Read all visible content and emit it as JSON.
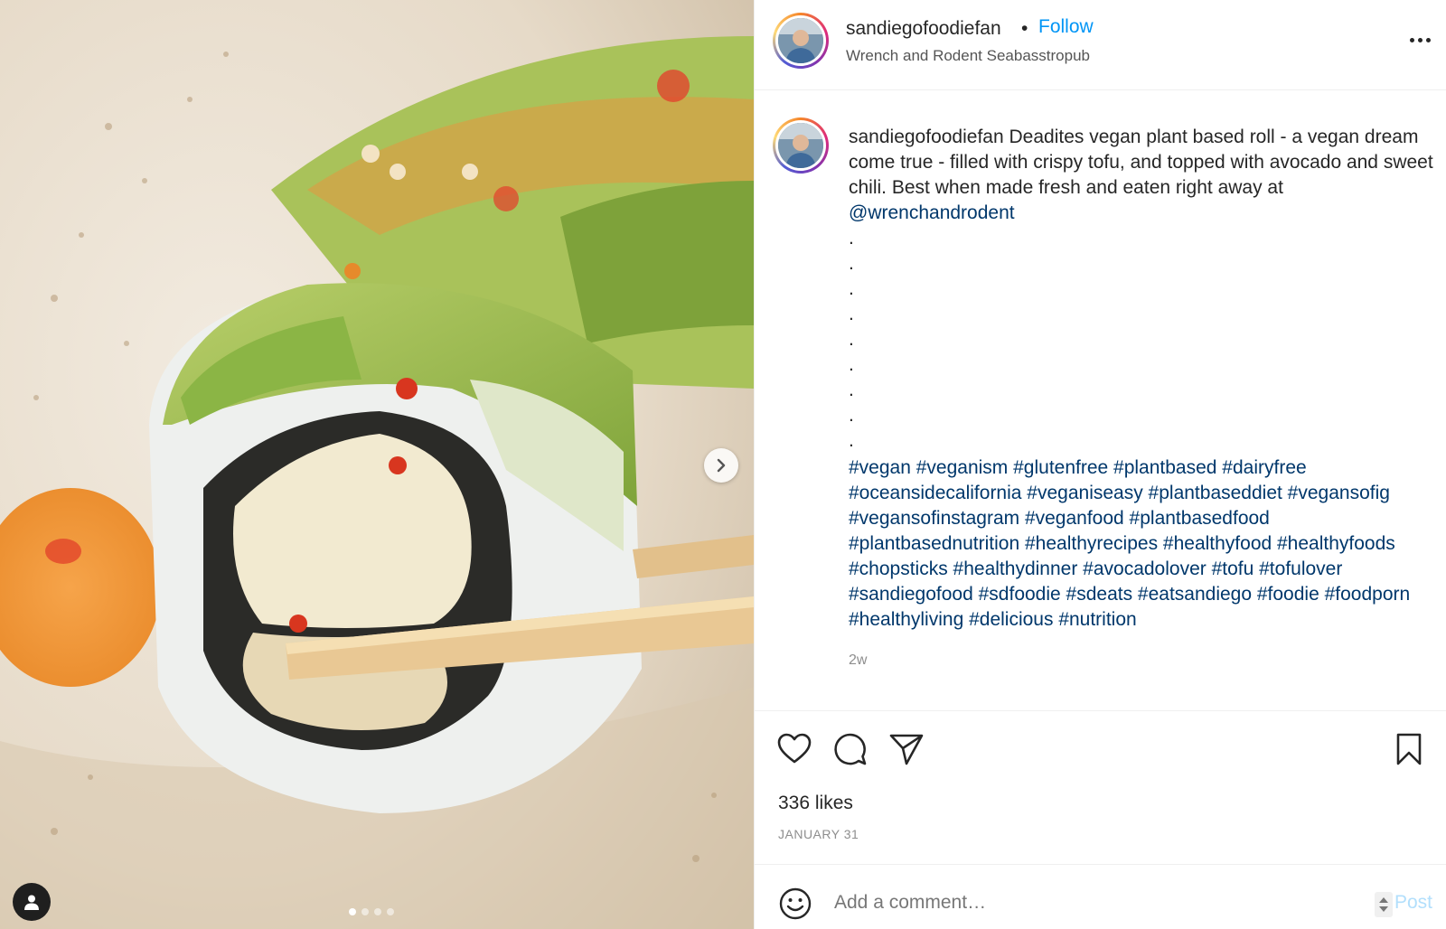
{
  "post": {
    "username": "sandiegofoodiefan",
    "separator": "•",
    "follow_label": "Follow",
    "location": "Wrench and Rodent Seabasstropub"
  },
  "caption": {
    "username": "sandiegofoodiefan",
    "text": "Deadites vegan plant based roll - a vegan dream come true - filled with crispy tofu, and topped with avocado and sweet chili. Best when made fresh and eaten right away at",
    "mention": "@wrenchandrodent",
    "dots": [
      ".",
      ".",
      ".",
      ".",
      ".",
      ".",
      ".",
      ".",
      "."
    ],
    "hashtags": "#vegan #veganism #glutenfree #plantbased #dairyfree #oceansidecalifornia #veganiseasy #plantbaseddiet #vegansofig #vegansofinstagram #veganfood #plantbasedfood #plantbasednutrition #healthyrecipes #healthyfood #healthyfoods #chopsticks #healthydinner #avocadolover #tofu #tofulover #sandiegofood #sdfoodie #sdeats #eatsandiego #foodie #foodporn #healthyliving #delicious #nutrition",
    "time_ago": "2w"
  },
  "actions": {
    "icons": [
      "heart-icon",
      "comment-icon",
      "share-icon",
      "bookmark-icon"
    ],
    "likes": "336 likes",
    "date": "JANUARY 31"
  },
  "comment": {
    "placeholder": "Add a comment…",
    "post_label": "Post"
  },
  "media": {
    "carousel_total": 4,
    "carousel_active": 1,
    "icons": [
      "chevron-right-icon",
      "user-tag-icon"
    ]
  },
  "colors": {
    "link": "#00376b",
    "follow": "#0095f6",
    "post_disabled": "#b2dffc",
    "muted": "#8e8e8e"
  }
}
